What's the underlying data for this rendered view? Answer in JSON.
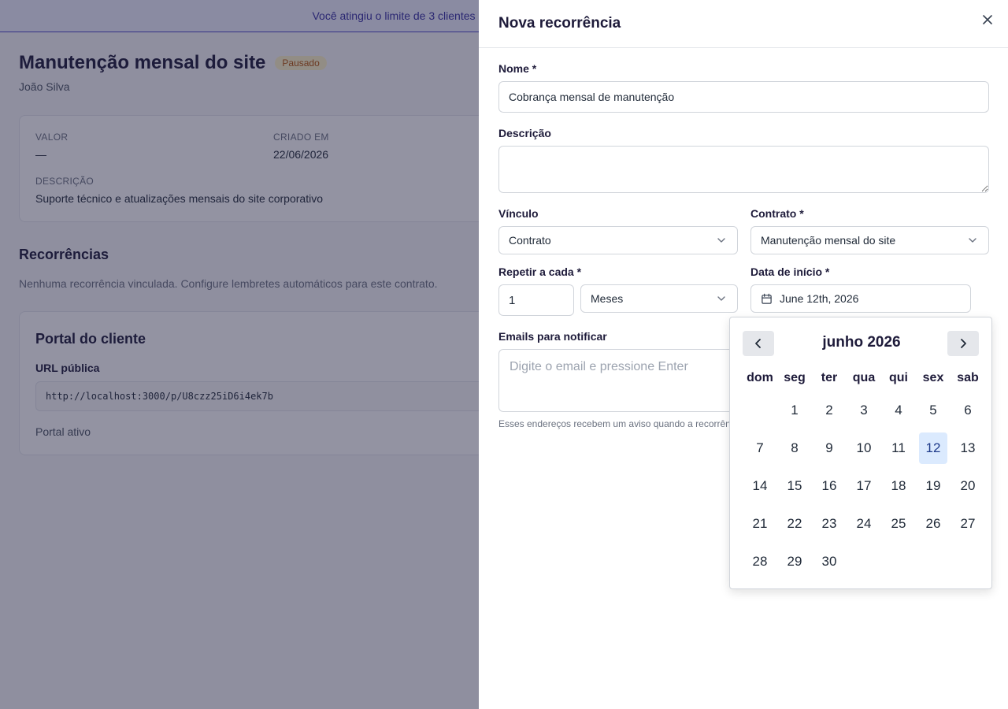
{
  "background": {
    "banner_text": "Você atingiu o limite de 3 clientes",
    "title": "Manutenção mensal do site",
    "status_badge": "Pausado",
    "client_name": "João Silva",
    "info": {
      "valor_label": "VALOR",
      "valor_value": "—",
      "criado_label": "CRIADO EM",
      "criado_value": "22/06/2026",
      "descricao_label": "DESCRIÇÃO",
      "descricao_value": "Suporte técnico e atualizações mensais do site corporativo"
    },
    "recorrencias_title": "Recorrências",
    "recorrencias_note": "Nenhuma recorrência vinculada. Configure lembretes automáticos para este contrato.",
    "portal": {
      "title": "Portal do cliente",
      "url_label": "URL pública",
      "url": "http://localhost:3000/p/U8czz25iD6i4ek7b",
      "status": "Portal ativo"
    }
  },
  "drawer": {
    "title": "Nova recorrência",
    "close_label": "×",
    "nome_label": "Nome *",
    "nome_value": "Cobrança mensal de manutenção",
    "descricao_label": "Descrição",
    "descricao_value": "",
    "vinculo_label": "Vínculo",
    "vinculo_value": "Contrato",
    "contrato_label": "Contrato *",
    "contrato_value": "Manutenção mensal do site",
    "repetir_label": "Repetir a cada *",
    "repetir_value": "1",
    "unidade_value": "Meses",
    "data_label": "Data de início *",
    "data_value": "June 12th, 2026",
    "emails_label": "Emails para notificar",
    "emails_placeholder": "Digite o email e pressione Enter",
    "emails_helper": "Esses endereços recebem um aviso quando a recorrência"
  },
  "calendar": {
    "month_label": "junho 2026",
    "weekdays": [
      "dom",
      "seg",
      "ter",
      "qua",
      "qui",
      "sex",
      "sab"
    ],
    "weeks": [
      [
        "",
        "1",
        "2",
        "3",
        "4",
        "5",
        "6"
      ],
      [
        "7",
        "8",
        "9",
        "10",
        "11",
        "12",
        "13"
      ],
      [
        "14",
        "15",
        "16",
        "17",
        "18",
        "19",
        "20"
      ],
      [
        "21",
        "22",
        "23",
        "24",
        "25",
        "26",
        "27"
      ],
      [
        "28",
        "29",
        "30",
        "",
        "",
        "",
        ""
      ]
    ],
    "selected_day": "12",
    "selected_color": "#dbeafe"
  },
  "colors": {
    "accent": "#4b46c8",
    "badge_bg": "#fef3c7",
    "badge_text": "#b45309"
  }
}
